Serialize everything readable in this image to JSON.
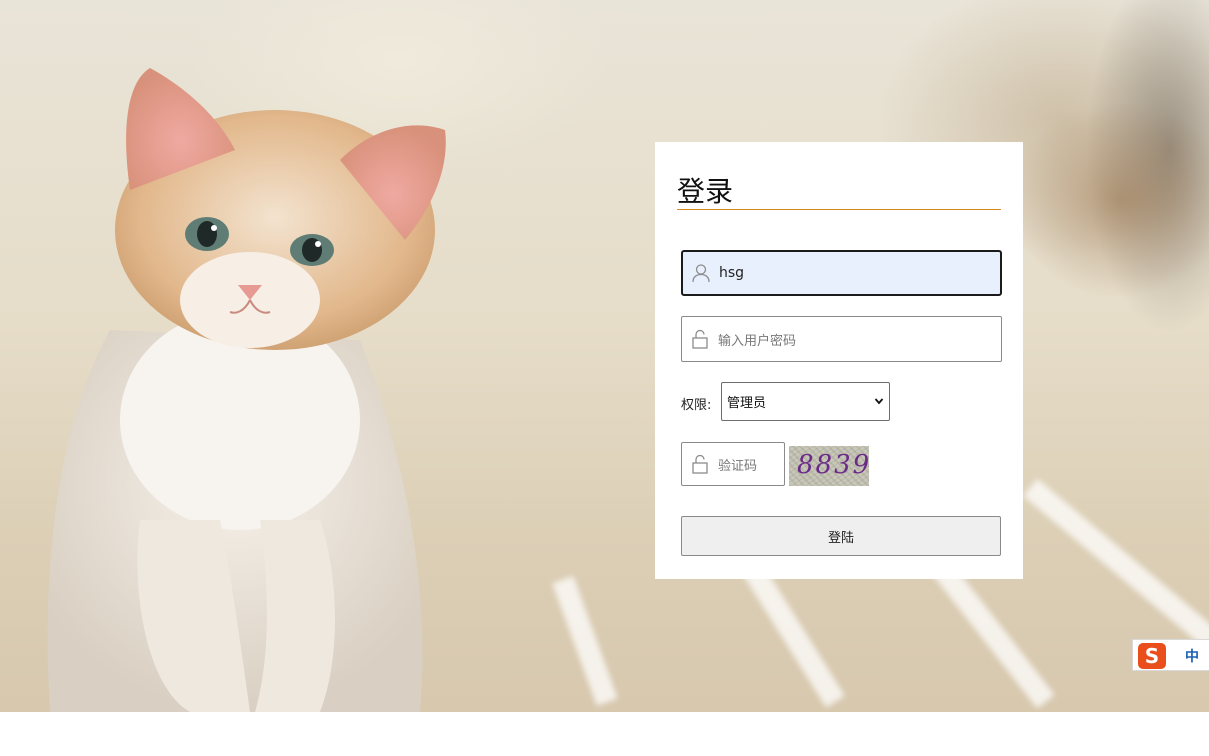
{
  "login": {
    "title": "登录",
    "username_value": "hsg",
    "password_placeholder": "输入用户密码",
    "permission_label": "权限:",
    "permission_selected": "管理员",
    "captcha_placeholder": "验证码",
    "captcha_image_text": "8839",
    "submit_label": "登陆"
  },
  "ime": {
    "logo": "S",
    "mode": "中"
  },
  "colors": {
    "title_rule": "#d48b1e",
    "active_field_bg": "#e8f0fe",
    "ime_logo": "#e94e1b",
    "ime_mode": "#1b5fb3"
  },
  "icons": {
    "username": "user-icon",
    "password": "lock-icon",
    "captcha": "lock-icon",
    "select": "chevron-down-icon"
  }
}
